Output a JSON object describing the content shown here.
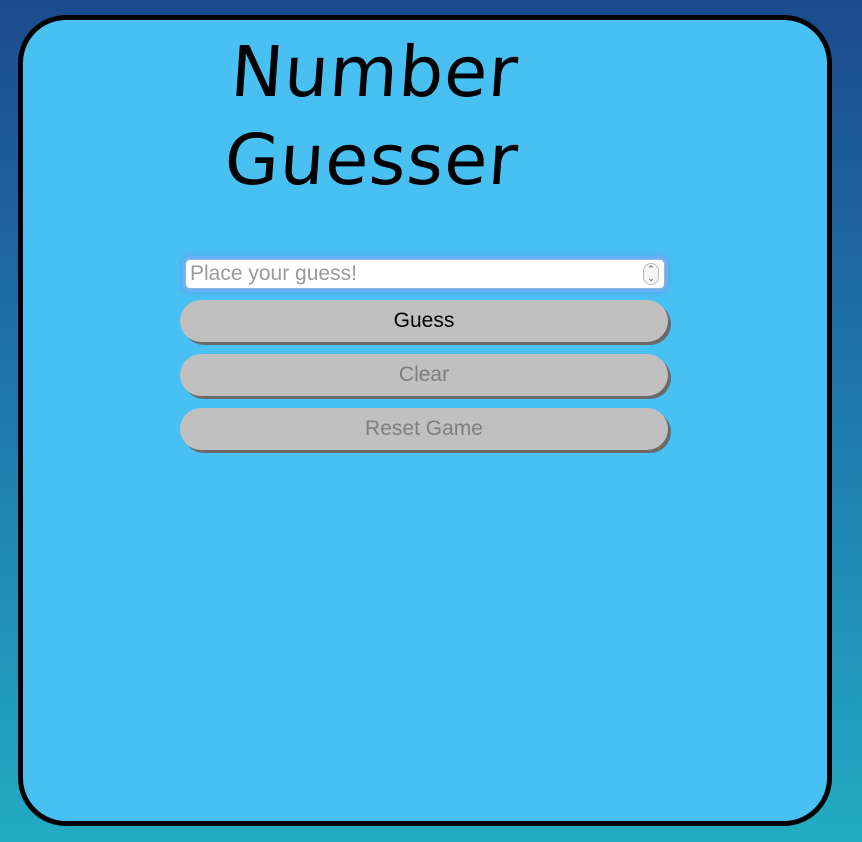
{
  "game": {
    "title_line1": "Number",
    "title_line2": "Guesser"
  },
  "input": {
    "placeholder": "Place your guess!",
    "value": "",
    "stepper_up": "⌃",
    "stepper_down": "⌄"
  },
  "buttons": {
    "guess": "Guess",
    "clear": "Clear",
    "reset": "Reset Game"
  },
  "colors": {
    "card_background": "#49c0f2",
    "page_gradient_top": "#1c4a8e",
    "page_gradient_bottom": "#22acc2",
    "button_background": "#c0c0c0"
  }
}
